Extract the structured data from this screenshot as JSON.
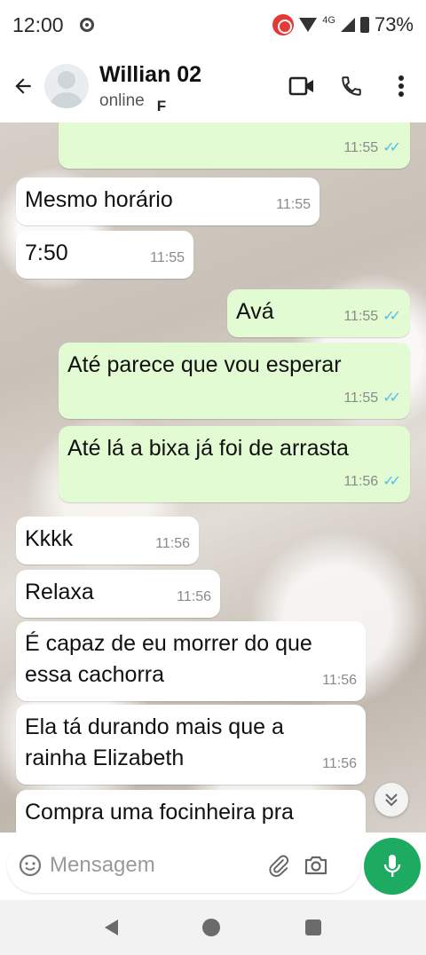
{
  "status_bar": {
    "time": "12:00",
    "network": "4G",
    "battery": "73%"
  },
  "header": {
    "contact_name": "Willian 02",
    "contact_status": "online",
    "typing_mark": "F",
    "icons": [
      "back-arrow-icon",
      "video-call-icon",
      "phone-icon",
      "more-vert-icon"
    ]
  },
  "messages": [
    {
      "direction": "out",
      "text": "",
      "time": "11:55",
      "read": true
    },
    {
      "direction": "in",
      "text": "Mesmo horário",
      "time": "11:55"
    },
    {
      "direction": "in",
      "text": "7:50",
      "time": "11:55"
    },
    {
      "direction": "out",
      "text": "Avá",
      "time": "11:55",
      "read": true
    },
    {
      "direction": "out",
      "text": "Até parece que vou esperar",
      "time": "11:55",
      "read": true
    },
    {
      "direction": "out",
      "text": "Até lá a bixa já foi de arrasta",
      "time": "11:56",
      "read": true
    },
    {
      "direction": "in",
      "text": "Kkkk",
      "time": "11:56"
    },
    {
      "direction": "in",
      "text": "Relaxa",
      "time": "11:56"
    },
    {
      "direction": "in",
      "text": "É capaz de eu morrer do que essa cachorra",
      "time": "11:56"
    },
    {
      "direction": "in",
      "text": "Ela tá durando mais que a rainha Elizabeth",
      "time": "11:56"
    },
    {
      "direction": "in",
      "text": "Compra uma focinheira pra",
      "time": ""
    }
  ],
  "input": {
    "placeholder": "Mensagem"
  },
  "colors": {
    "outgoing_bubble": "#e2fbd2",
    "incoming_bubble": "#ffffff",
    "read_ticks": "#53bdeb",
    "mic_button": "#1daa61"
  }
}
